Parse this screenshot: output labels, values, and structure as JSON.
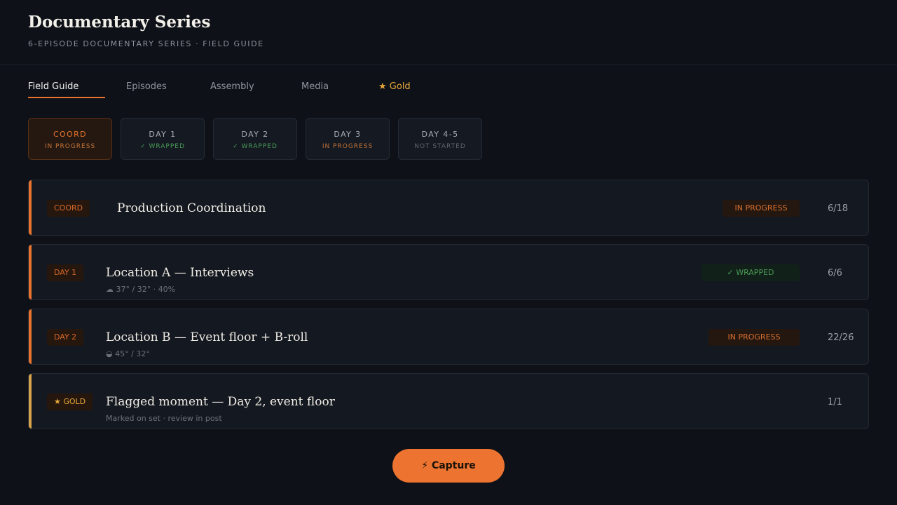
{
  "header": {
    "title": "Documentary Series",
    "subtitle": "6-EPISODE DOCUMENTARY SERIES · FIELD GUIDE"
  },
  "tabs": [
    {
      "label": "Field Guide",
      "active": true
    },
    {
      "label": "Episodes"
    },
    {
      "label": "Assembly"
    },
    {
      "label": "Media"
    },
    {
      "label": "★ Gold"
    }
  ],
  "stages": [
    {
      "name": "COORD",
      "status": "IN PROGRESS",
      "active": true
    },
    {
      "name": "DAY 1",
      "status": "✓ WRAPPED"
    },
    {
      "name": "DAY 2",
      "status": "✓ WRAPPED"
    },
    {
      "name": "DAY 3",
      "status": "IN PROGRESS"
    },
    {
      "name": "DAY 4-5",
      "status": "NOT STARTED"
    }
  ],
  "cards": [
    {
      "chip": "COORD",
      "title": "Production Coordination",
      "meta": "",
      "status": "IN PROGRESS",
      "count": "6/18"
    },
    {
      "chip": "DAY 1",
      "title": "Location A — Interviews",
      "meta": "☁ 37° / 32° · 40%",
      "status": "✓ WRAPPED",
      "count": "6/6"
    },
    {
      "chip": "DAY 2",
      "title": "Location B — Event floor + B-roll",
      "meta": "◒ 45° / 32°",
      "status": "IN PROGRESS",
      "count": "22/26"
    },
    {
      "chip": "★ GOLD",
      "title": "Flagged moment — Day 2, event floor",
      "meta": "Marked on set · review in post",
      "status": "",
      "count": "1/1"
    }
  ],
  "capture": {
    "label": "⚡ Capture"
  },
  "colors": {
    "accent": "#e8732c",
    "gold": "#d6a24a",
    "wrapped": "#4a9b56",
    "background": "#0e1117"
  }
}
